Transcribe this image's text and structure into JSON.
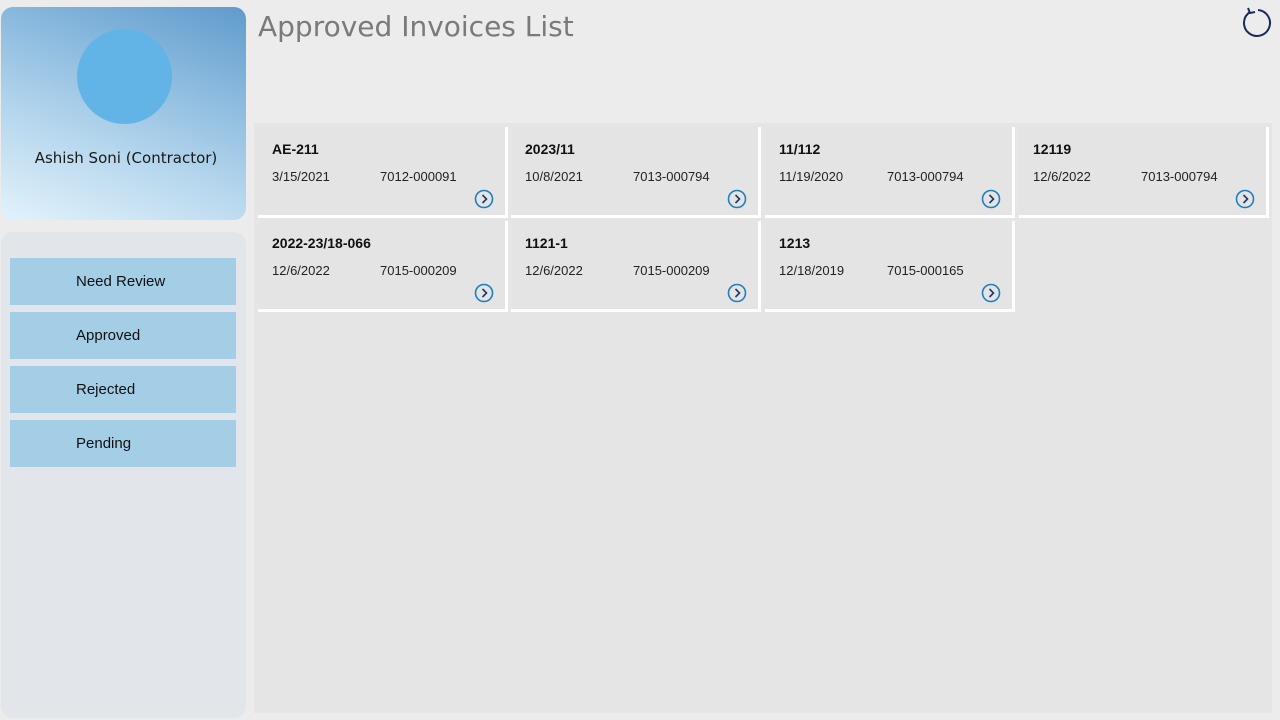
{
  "page": {
    "title": "Approved Invoices List"
  },
  "profile": {
    "name": "Ashish Soni (Contractor)"
  },
  "nav": {
    "items": [
      {
        "label": "Need Review"
      },
      {
        "label": "Approved"
      },
      {
        "label": "Rejected"
      },
      {
        "label": "Pending"
      }
    ]
  },
  "icons": {
    "refresh": "refresh-icon",
    "arrow": "chevron-right-circle-icon"
  },
  "colors": {
    "accent": "#1f7fbf",
    "nav_button": "#a4cde6",
    "avatar": "#62b4e6",
    "refresh": "#1b2a5a"
  },
  "invoices": [
    {
      "id": "AE-211",
      "date": "3/15/2021",
      "vendor": "7012-000091"
    },
    {
      "id": "2023/11",
      "date": "10/8/2021",
      "vendor": "7013-000794"
    },
    {
      "id": "11/112",
      "date": "11/19/2020",
      "vendor": "7013-000794"
    },
    {
      "id": "12119",
      "date": "12/6/2022",
      "vendor": "7013-000794"
    },
    {
      "id": "2022-23/18-066",
      "date": "12/6/2022",
      "vendor": "7015-000209"
    },
    {
      "id": "1121-1",
      "date": "12/6/2022",
      "vendor": "7015-000209"
    },
    {
      "id": "1213",
      "date": "12/18/2019",
      "vendor": "7015-000165"
    }
  ]
}
